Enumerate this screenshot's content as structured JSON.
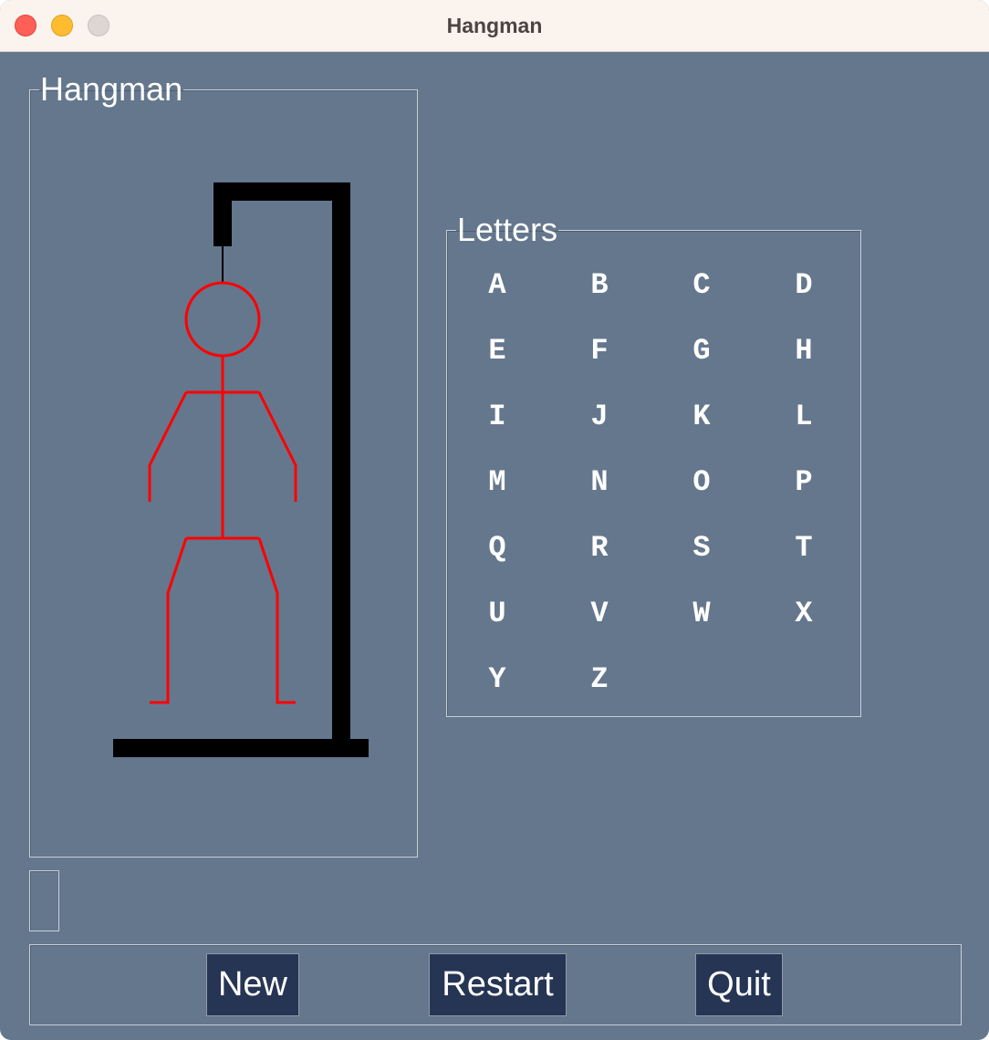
{
  "window": {
    "title": "Hangman"
  },
  "hangman_panel": {
    "label": "Hangman",
    "figure_color": "#ff0000",
    "gallows_color": "#000000"
  },
  "letters_panel": {
    "label": "Letters",
    "letters": [
      "A",
      "B",
      "C",
      "D",
      "E",
      "F",
      "G",
      "H",
      "I",
      "J",
      "K",
      "L",
      "M",
      "N",
      "O",
      "P",
      "Q",
      "R",
      "S",
      "T",
      "U",
      "V",
      "W",
      "X",
      "Y",
      "Z"
    ]
  },
  "status": {
    "message": ""
  },
  "buttons": {
    "new_label": "New",
    "restart_label": "Restart",
    "quit_label": "Quit"
  },
  "colors": {
    "background": "#64778d",
    "button": "#263553",
    "titlebar": "#fbf3ee"
  }
}
